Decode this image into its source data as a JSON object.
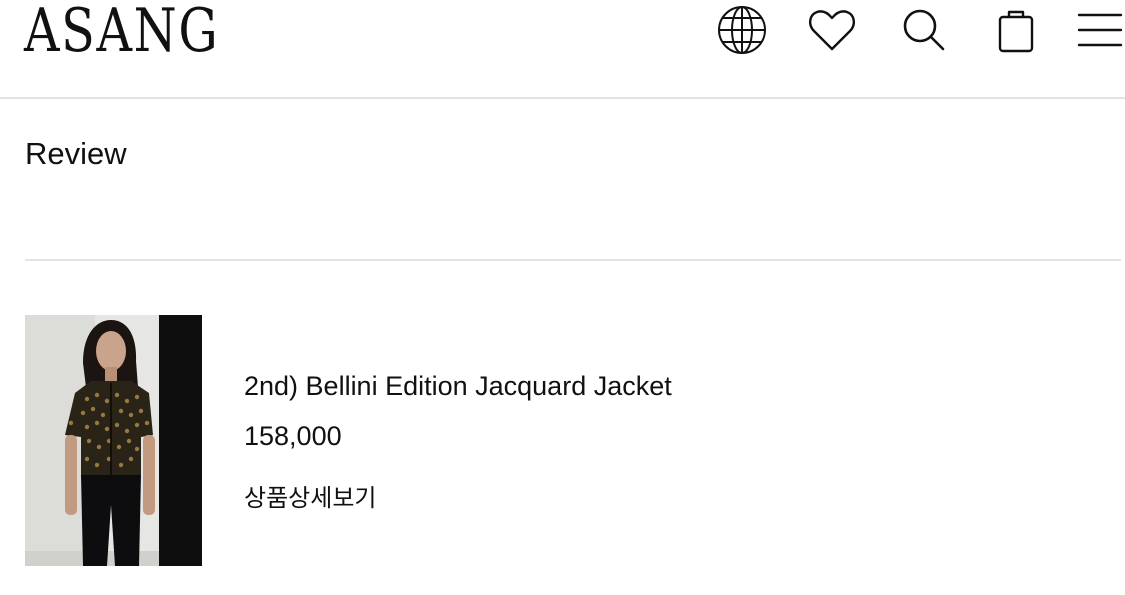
{
  "header": {
    "logo": "ASANG",
    "icons": [
      "globe-icon",
      "heart-icon",
      "search-icon",
      "shopping-bag-icon",
      "menu-icon"
    ]
  },
  "main": {
    "section_title": "Review",
    "product": {
      "name": "2nd) Bellini Edition Jacquard Jacket",
      "price": "158,000",
      "detail_link": "상품상세보기",
      "image": "product-photo"
    }
  },
  "colors": {
    "text": "#111111",
    "divider": "#e2e2e2",
    "background": "#ffffff"
  }
}
